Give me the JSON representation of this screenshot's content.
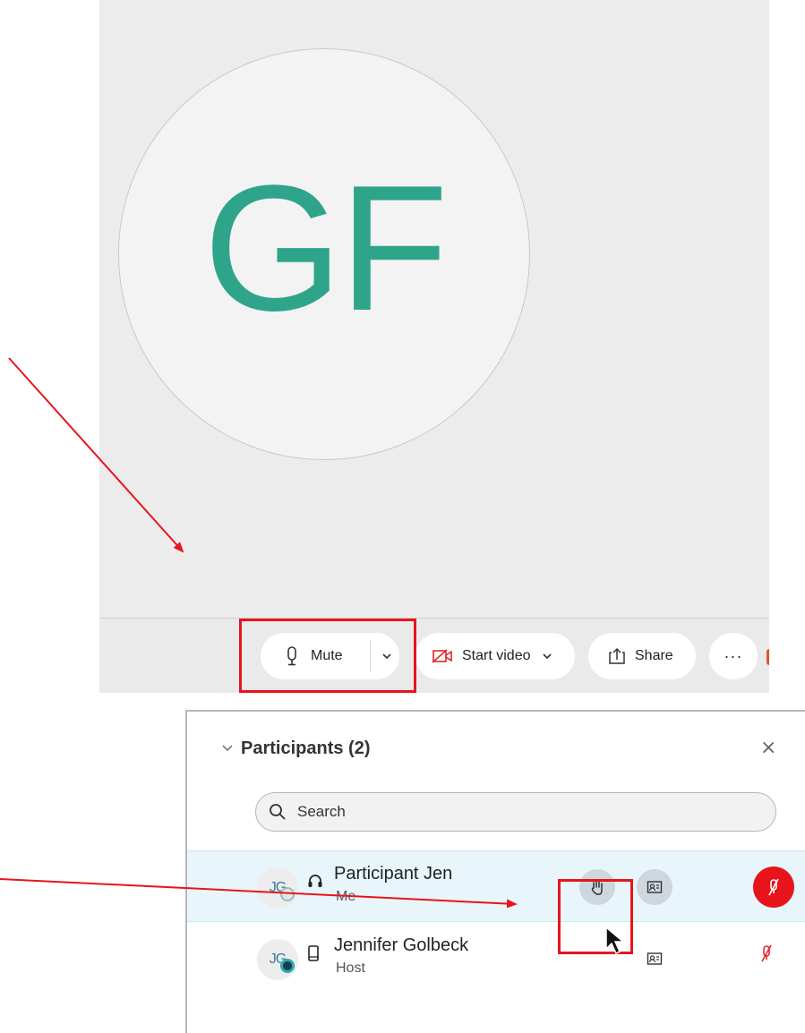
{
  "fragments": {
    "a": "a",
    "colon": ":"
  },
  "meeting": {
    "avatar_initials": "GF",
    "toolbar": {
      "mute_label": "Mute",
      "video_label": "Start video",
      "share_label": "Share",
      "more_label": "···"
    }
  },
  "participants": {
    "title": "Participants (2)",
    "close_glyph": "×",
    "search": {
      "placeholder": "Search",
      "value": ""
    },
    "rows": [
      {
        "initials": "JG",
        "name": "Participant Jen",
        "role": "Me",
        "device_icon": "headset-icon",
        "hand_raised_button": true,
        "muted": true
      },
      {
        "initials": "JG",
        "name": "Jennifer Golbeck",
        "role": "Host",
        "device_icon": "phone-icon",
        "muted": true
      }
    ]
  },
  "colors": {
    "avatar_green": "#2ea58a",
    "highlight_red": "#e8141c",
    "selected_row": "#e8f5fa",
    "toolbar_bg": "#eaeaea"
  }
}
